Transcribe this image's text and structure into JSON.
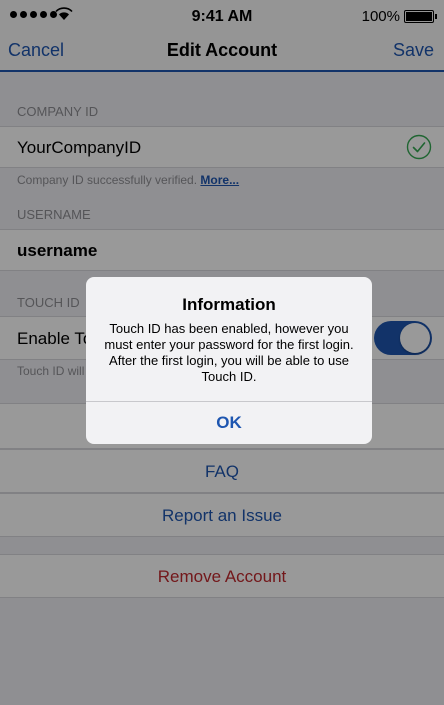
{
  "status_bar": {
    "time": "9:41 AM",
    "battery_percent": "100%"
  },
  "nav": {
    "cancel_label": "Cancel",
    "title": "Edit Account",
    "save_label": "Save"
  },
  "company_section": {
    "header": "COMPANY ID",
    "value": "YourCompanyID",
    "footnote_text": "Company ID successfully verified. ",
    "footnote_link": "More..."
  },
  "username_section": {
    "header": "USERNAME",
    "value": "username"
  },
  "touchid_section": {
    "header": "TOUCH ID",
    "row_label": "Enable Touch ID",
    "toggle_on": true,
    "footnote": "Touch ID will be enabled after your first successful login."
  },
  "links": {
    "faq": "FAQ",
    "report_issue": "Report an Issue",
    "remove_account": "Remove Account"
  },
  "alert": {
    "title": "Information",
    "message": "Touch ID has been enabled, however you must enter your password for the first login. After the first login, you will be able to use Touch ID.",
    "ok_label": "OK"
  },
  "colors": {
    "accent": "#1e56b0",
    "destructive": "#c0282d",
    "success": "#34a853"
  }
}
